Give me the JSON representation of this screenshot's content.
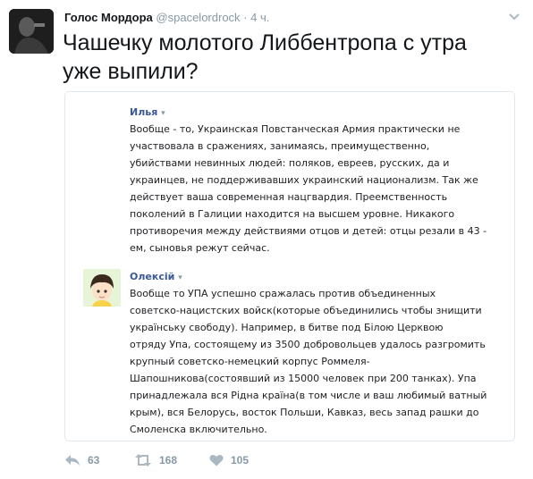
{
  "tweet": {
    "author_name": "Голос Мордора",
    "author_handle": "@spacelordrock",
    "separator": "·",
    "time": "4 ч.",
    "text": "Чашечку молотого Либбентропа с утра уже выпили?"
  },
  "comments": [
    {
      "name": "Илья",
      "lines": [
        "Вообще - то, Украинская Повстанческая Армия практически не",
        "участвовала в сражениях, занимаясь, преимущественно,",
        "убийствами невинных людей: поляков, евреев, русских, да и",
        "украинцев, не поддерживавших украинский национализм. Так же",
        "действует ваша современная нацгвардия. Преемственность",
        "поколений в Галиции находится на высшем уровне. Никакого",
        "противоречия между действиями отцов и детей: отцы резали в 43 -",
        "ем, сыновья режут сейчас."
      ]
    },
    {
      "name": "Олексій",
      "lines": [
        "Вообще то УПА успешно сражалась против объединенных",
        "советско-нацистских войск(которые объединились чтобы знищити",
        "українську свободу). Например, в битве под Білою Церквою",
        "отряду Упа, состоящему из 3500 добровольцев удалось разгромить",
        "крупный советско-немецкий корпус Роммеля-",
        "Шапошникова(состоявший из 15000 человек при 200 танках). Упа",
        "принадлежала вся Рідна країна(в том числе и ваш любимый ватный",
        "крым), вся Белорусь, восток Польши, Кавказ, весь запад рашки до",
        "Смоленска включительно."
      ]
    }
  ],
  "actions": {
    "reply_count": "63",
    "retweet_count": "168",
    "like_count": "105"
  },
  "icons": {
    "more": "chevron-down-icon",
    "reply": "reply-icon",
    "retweet": "retweet-icon",
    "like": "heart-icon"
  },
  "colors": {
    "accent": "#3b5998",
    "muted": "#8899a6",
    "text": "#14171a"
  }
}
